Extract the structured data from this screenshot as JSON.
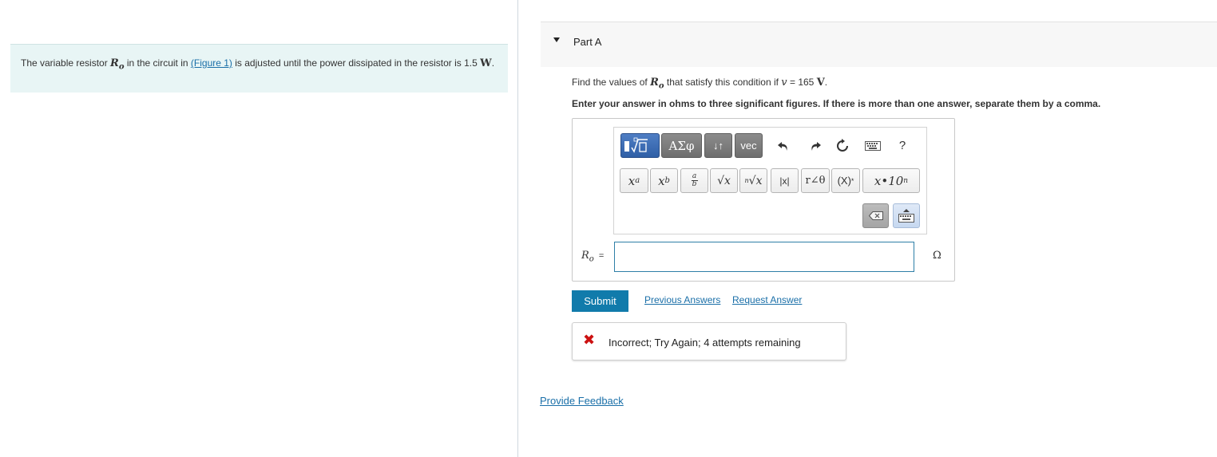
{
  "intro": {
    "t1": "The variable resistor ",
    "var_R": "R",
    "var_sub": "o",
    "t2": " in the circuit in ",
    "figure_link": "(Figure 1)",
    "t3": " is adjusted until the power dissipated in the resistor is 1.5 ",
    "unit_W": "W",
    "t4": "."
  },
  "part": {
    "title": "Part A"
  },
  "question": {
    "t1": "Find the values of ",
    "var_R": "R",
    "var_sub": "o",
    "t2": " that satisfy this condition if ",
    "var_v": "v",
    "t3": " = 165 ",
    "unit_V": "V",
    "t4": ".",
    "instructions": "Enter your answer in ohms to three significant figures. If there is more than one answer, separate them by a comma."
  },
  "toolbar": {
    "templates_label": "▮√▢",
    "greek_label": "ΑΣφ",
    "arrows_label": "↓↑",
    "vec_label": "vec",
    "help_label": "?",
    "sup_x": "x",
    "sup_a": "a",
    "sub_x": "x",
    "sub_b": "b",
    "frac_top": "a",
    "frac_bot": "b",
    "sqrt_label": "√x",
    "nroot_n": "n",
    "nroot_label": "√x",
    "abs_label": "|x|",
    "polar_label": "r∠θ",
    "conj_label": "(X)",
    "conj_star": "*",
    "sci_label": "x•10",
    "sci_n": "n"
  },
  "answer": {
    "label_R": "R",
    "label_sub": "o",
    "label_eq": "=",
    "value": "",
    "unit": "Ω"
  },
  "actions": {
    "submit": "Submit",
    "previous_answers": "Previous Answers",
    "request_answer": "Request Answer"
  },
  "feedback": {
    "icon": "✖",
    "message": "Incorrect; Try Again; 4 attempts remaining"
  },
  "footer": {
    "provide_feedback": "Provide Feedback"
  }
}
